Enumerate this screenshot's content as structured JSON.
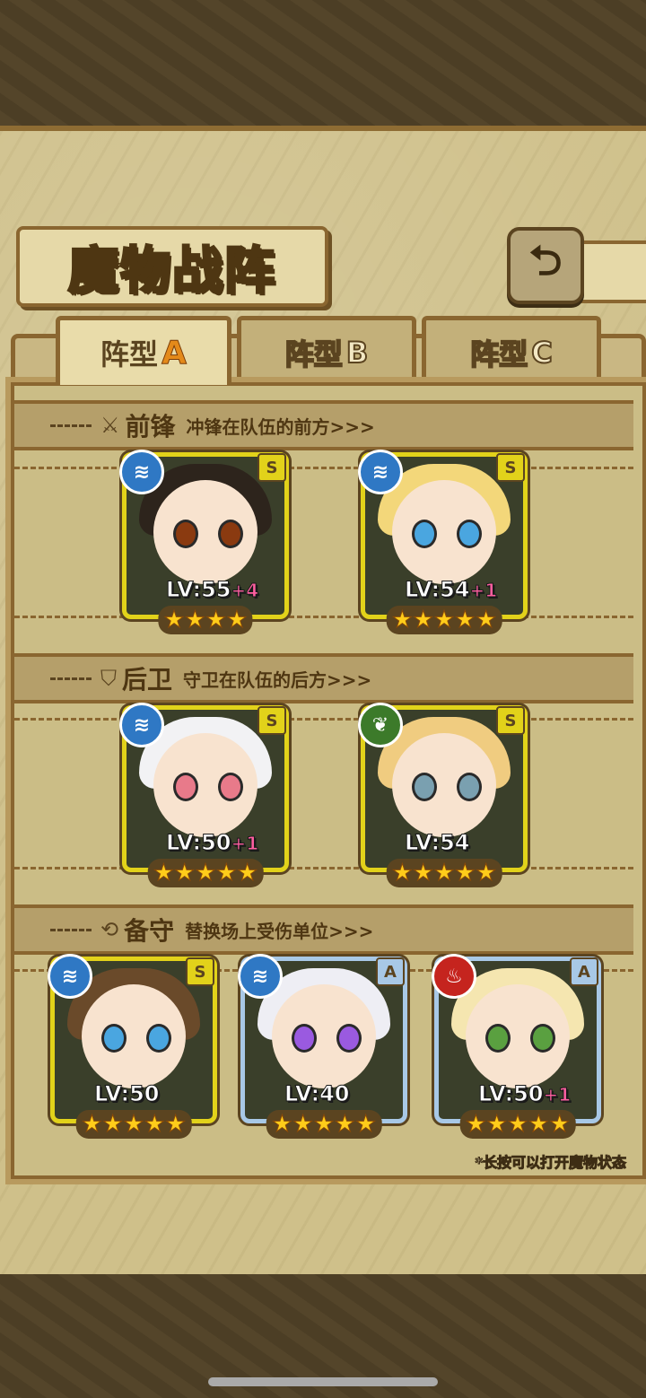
{
  "title": "魔物战阵",
  "tabs": [
    {
      "text": "阵型",
      "letter": "A",
      "active": true
    },
    {
      "text": "阵型",
      "letter": "B",
      "active": false
    },
    {
      "text": "阵型",
      "letter": "C",
      "active": false
    }
  ],
  "sections": {
    "front": {
      "name": "前锋",
      "desc": "冲锋在队伍的前方>>>",
      "icon": "sword-icon"
    },
    "back": {
      "name": "后卫",
      "desc": "守卫在队伍的后方>>>",
      "icon": "shield-icon"
    },
    "reserve": {
      "name": "备守",
      "desc": "替换场上受伤单位>>>",
      "icon": "swap-icon"
    }
  },
  "cards": {
    "f1": {
      "element": "water",
      "rank": "S",
      "lv": "LV:55",
      "plus": "+4",
      "stars": "★★★★"
    },
    "f2": {
      "element": "water",
      "rank": "S",
      "lv": "LV:54",
      "plus": "+1",
      "stars": "★★★★★"
    },
    "b1": {
      "element": "water",
      "rank": "S",
      "lv": "LV:50",
      "plus": "+1",
      "stars": "★★★★★"
    },
    "b2": {
      "element": "wood",
      "rank": "S",
      "lv": "LV:54",
      "plus": "",
      "stars": "★★★★★"
    },
    "r1": {
      "element": "water",
      "rank": "S",
      "lv": "LV:50",
      "plus": "",
      "stars": "★★★★★"
    },
    "r2": {
      "element": "water",
      "rank": "A",
      "lv": "LV:40",
      "plus": "",
      "stars": "★★★★★"
    },
    "r3": {
      "element": "fire",
      "rank": "A",
      "lv": "LV:50",
      "plus": "+1",
      "stars": "★★★★★"
    }
  },
  "hint": "*长按可以打开魔物状态",
  "icons": {
    "back": "back-arrow-icon",
    "water": "water-element-icon",
    "wood": "wood-element-icon",
    "fire": "fire-element-icon"
  }
}
